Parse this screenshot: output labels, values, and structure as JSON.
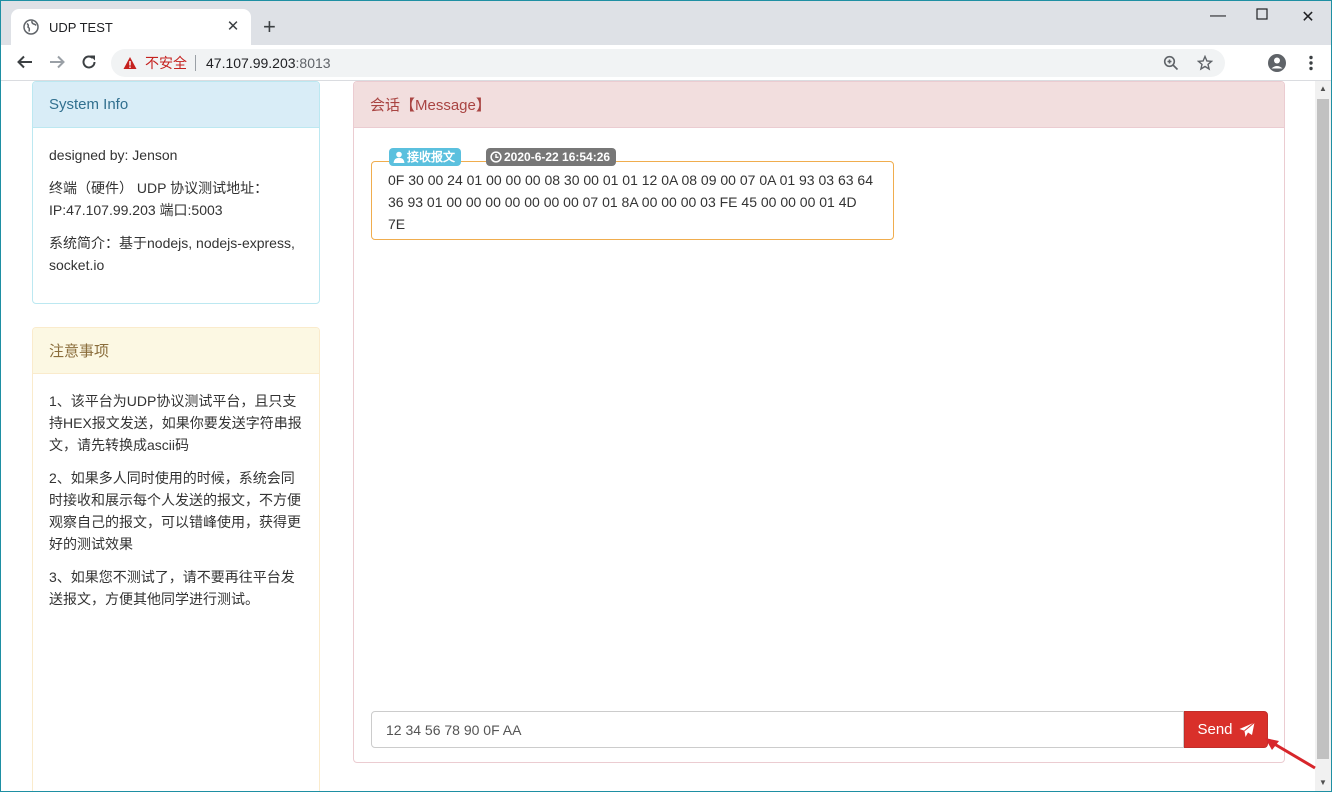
{
  "browser": {
    "tab_title": "UDP TEST",
    "new_tab": "+",
    "address": {
      "security_label": "不安全",
      "host": "47.107.99.203",
      "port": ":8013"
    }
  },
  "sidebar": {
    "info": {
      "heading": "System Info",
      "designed_by": "designed by: Jenson",
      "address_line": "终端（硬件） UDP 协议测试地址：IP:47.107.99.203 端口:5003",
      "summary": "系统简介：基于nodejs, nodejs-express, socket.io"
    },
    "notice": {
      "heading": "注意事项",
      "items": [
        "1、该平台为UDP协议测试平台，且只支持HEX报文发送，如果你要发送字符串报文，请先转换成ascii码",
        "2、如果多人同时使用的时候，系统会同时接收和展示每个人发送的报文，不方便观察自己的报文，可以错峰使用，获得更好的测试效果",
        "3、如果您不测试了，请不要再往平台发送报文，方便其他同学进行测试。"
      ]
    }
  },
  "message_panel": {
    "heading": "会话【Message】",
    "messages": [
      {
        "tag": "接收报文",
        "time": "2020-6-22 16:54:26",
        "content": "0F 30 00 24 01 00 00 00 08 30 00 01 01 12 0A 08 09 00 07 0A 01 93 03 63 64 36 93 01 00 00 00 00 00 00 00 07 01 8A 00 00 00 03 FE 45 00 00 00 01 4D 7E"
      }
    ],
    "input_value": "12 34 56 78 90 0F AA",
    "send_label": "Send"
  },
  "colors": {
    "info_heading_bg": "#d9edf7",
    "notice_heading_bg": "#fcf8e3",
    "message_heading_bg": "#f2dede",
    "send_button": "#d9302a",
    "recv_badge": "#5bc0de",
    "bubble_border": "#f0ad4e"
  }
}
